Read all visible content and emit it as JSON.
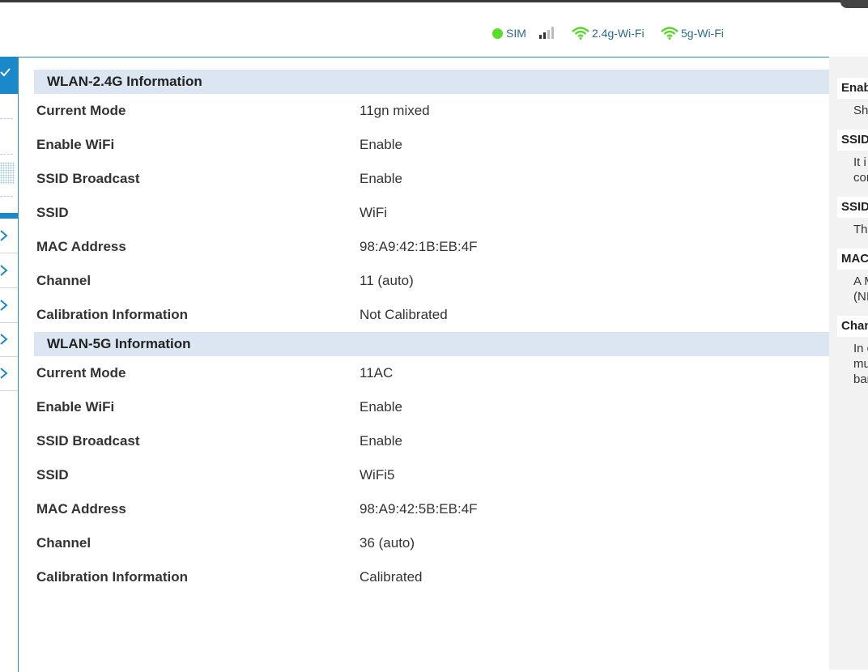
{
  "status": {
    "sim_label": "SIM",
    "wifi24_label": "2.4g-Wi-Fi",
    "wifi5_label": "5g-Wi-Fi",
    "accent_green": "#55e024",
    "accent_blue": "#1a88c9"
  },
  "wlan24": {
    "title": "WLAN-2.4G Information",
    "rows": [
      {
        "label": "Current Mode",
        "value": "11gn mixed"
      },
      {
        "label": "Enable WiFi",
        "value": "Enable"
      },
      {
        "label": "SSID Broadcast",
        "value": "Enable"
      },
      {
        "label": "SSID",
        "value": "WiFi"
      },
      {
        "label": "MAC Address",
        "value": "98:A9:42:1B:EB:4F"
      },
      {
        "label": "Channel",
        "value": "11 (auto)"
      },
      {
        "label": "Calibration Information",
        "value": "Not Calibrated"
      }
    ]
  },
  "wlan5": {
    "title": "WLAN-5G Information",
    "rows": [
      {
        "label": "Current Mode",
        "value": "11AC"
      },
      {
        "label": "Enable WiFi",
        "value": "Enable"
      },
      {
        "label": "SSID Broadcast",
        "value": "Enable"
      },
      {
        "label": "SSID",
        "value": "WiFi5"
      },
      {
        "label": "MAC Address",
        "value": "98:A9:42:5B:EB:4F"
      },
      {
        "label": "Channel",
        "value": "36 (auto)"
      },
      {
        "label": "Calibration Information",
        "value": "Calibrated"
      }
    ]
  },
  "help": [
    {
      "title": "Enab",
      "text": [
        "She"
      ]
    },
    {
      "title": "SSID",
      "text": [
        "It i",
        "cor"
      ]
    },
    {
      "title": "SSID",
      "text": [
        "The"
      ]
    },
    {
      "title": "MAC",
      "text": [
        "A M",
        "(NI"
      ]
    },
    {
      "title": "Chan",
      "text": [
        "In c",
        "mu",
        "bar"
      ]
    }
  ]
}
